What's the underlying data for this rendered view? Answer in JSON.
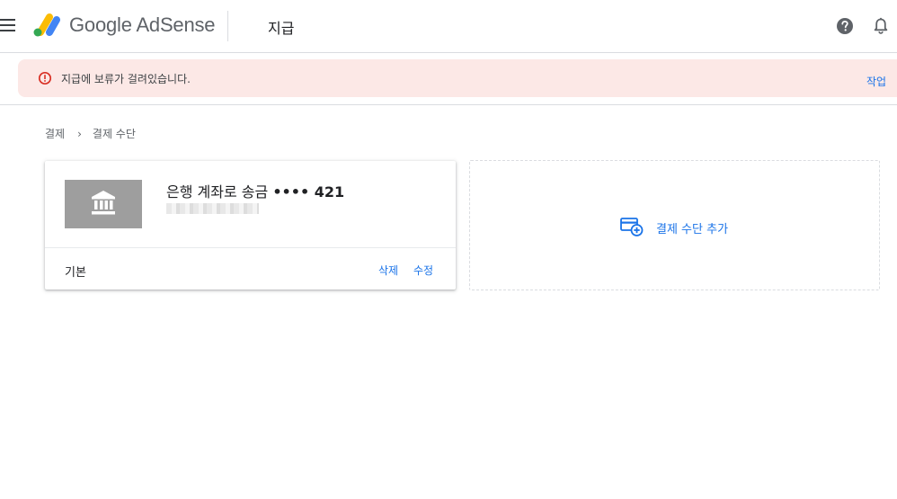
{
  "header": {
    "brand_google": "Google",
    "brand_product": "AdSense",
    "page_title": "지급",
    "icons": [
      "menu-icon",
      "adsense-logo",
      "help-icon",
      "notifications-icon"
    ]
  },
  "alert": {
    "message": "지급에 보류가 걸려있습니다.",
    "action_label": "작업",
    "icon": "error-icon",
    "color": "#d93025",
    "background": "#fce8e6"
  },
  "breadcrumb": {
    "items": [
      "결제",
      "결제 수단"
    ],
    "separator": "›"
  },
  "payment_method": {
    "title": "은행 계좌로 송금",
    "masked_number": "•••• 421",
    "icon": "bank-icon",
    "status": "기본",
    "delete_label": "삭제",
    "edit_label": "수정"
  },
  "add_method": {
    "label": "결제 수단 추가",
    "icon": "add-card-icon"
  },
  "colors": {
    "link": "#1a73e8",
    "logo_yellow": "#fbbc04",
    "logo_blue": "#4285f4",
    "logo_green": "#34a853"
  }
}
